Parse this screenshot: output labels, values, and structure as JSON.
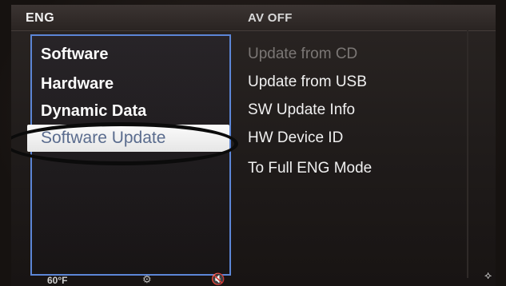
{
  "header": {
    "left_title": "ENG",
    "right_title": "AV OFF"
  },
  "menu": {
    "items": [
      {
        "label": "Software",
        "selected": false
      },
      {
        "label": "Hardware",
        "selected": false
      },
      {
        "label": "Dynamic Data",
        "selected": false
      },
      {
        "label": "Software Update",
        "selected": true
      }
    ]
  },
  "submenu": {
    "items": [
      {
        "label": "Update from CD",
        "enabled": false
      },
      {
        "label": "Update from USB",
        "enabled": true
      },
      {
        "label": "SW Update Info",
        "enabled": true
      },
      {
        "label": "HW Device ID",
        "enabled": true
      },
      {
        "label": "To Full ENG Mode",
        "enabled": true
      }
    ]
  },
  "footer": {
    "temperature": "60°F",
    "icons": [
      "gear-icon",
      "mute-icon",
      "settings-dot-icon"
    ]
  },
  "colors": {
    "selection_border": "#5c86d6",
    "selected_bg": "#f5f5f5",
    "selected_text": "#5a6c8e",
    "disabled_text": "#7b7775",
    "annotation_ring": "#0b0b0b"
  }
}
